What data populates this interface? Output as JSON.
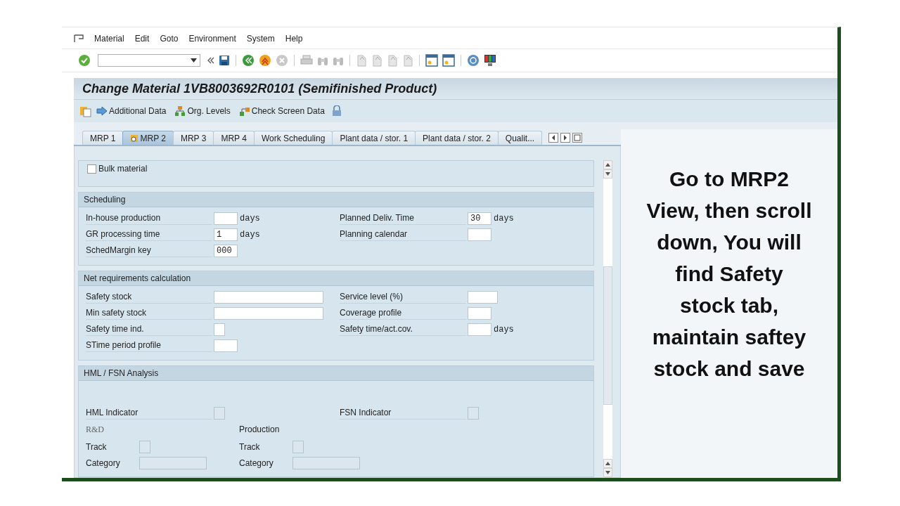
{
  "menu": [
    "Material",
    "Edit",
    "Goto",
    "Environment",
    "System",
    "Help"
  ],
  "title": "Change Material 1VB8003692R0101 (Semifinished Product)",
  "app_toolbar": [
    "Additional Data",
    "Org. Levels",
    "Check Screen Data"
  ],
  "tabs": [
    {
      "label": "MRP 1",
      "selected": false
    },
    {
      "label": "MRP 2",
      "selected": true
    },
    {
      "label": "MRP 3",
      "selected": false
    },
    {
      "label": "MRP 4",
      "selected": false
    },
    {
      "label": "Work Scheduling",
      "selected": false
    },
    {
      "label": "Plant data / stor. 1",
      "selected": false
    },
    {
      "label": "Plant data / stor. 2",
      "selected": false
    },
    {
      "label": "Qualit...",
      "selected": false
    }
  ],
  "bulk_material": {
    "label": "Bulk material",
    "checked": false
  },
  "sections": [
    {
      "title": "Scheduling",
      "left": [
        {
          "label": "In-house production",
          "kind": "short",
          "unit": "days"
        },
        {
          "label": "GR processing time",
          "kind": "short",
          "value": "1",
          "unit": "days"
        },
        {
          "label": "SchedMargin key",
          "kind": "short",
          "value": "000"
        }
      ],
      "right": [
        {
          "label": "Planned Deliv. Time",
          "kind": "short",
          "value": "30",
          "unit": "days"
        },
        {
          "label": "Planning calendar",
          "kind": "short"
        }
      ]
    },
    {
      "title": "Net requirements calculation",
      "left": [
        {
          "label": "Safety stock",
          "kind": "long"
        },
        {
          "label": "Min safety stock",
          "kind": "long"
        },
        {
          "label": "Safety time ind.",
          "kind": "tiny"
        },
        {
          "label": "STime period profile",
          "kind": "short"
        }
      ],
      "right": [
        {
          "label": "Service level (%)",
          "kind": "medium"
        },
        {
          "label": "Coverage profile",
          "kind": "short"
        },
        {
          "label": "Safety time/act.cov.",
          "kind": "short",
          "unit": "days"
        }
      ]
    }
  ],
  "hml": {
    "title": "HML / FSN Analysis",
    "left": {
      "label": "HML Indicator",
      "kind": "tiny",
      "disabled": true
    },
    "right": {
      "label": "FSN Indicator",
      "kind": "tiny",
      "disabled": true
    },
    "groups": [
      {
        "heading": "R&D",
        "fields": [
          {
            "label": "Track",
            "kind": "tiny",
            "disabled": true
          },
          {
            "label": "Category",
            "kind": "wide",
            "disabled": true
          }
        ]
      },
      {
        "heading": "Production",
        "fields": [
          {
            "label": "Track",
            "kind": "tiny",
            "disabled": true
          },
          {
            "label": "Category",
            "kind": "wide",
            "disabled": true
          }
        ]
      }
    ]
  },
  "caption": "Go to MRP2\nView, then scroll\ndown, You will\nfind Safety\nstock tab,\nmaintain saftey\nstock and save"
}
